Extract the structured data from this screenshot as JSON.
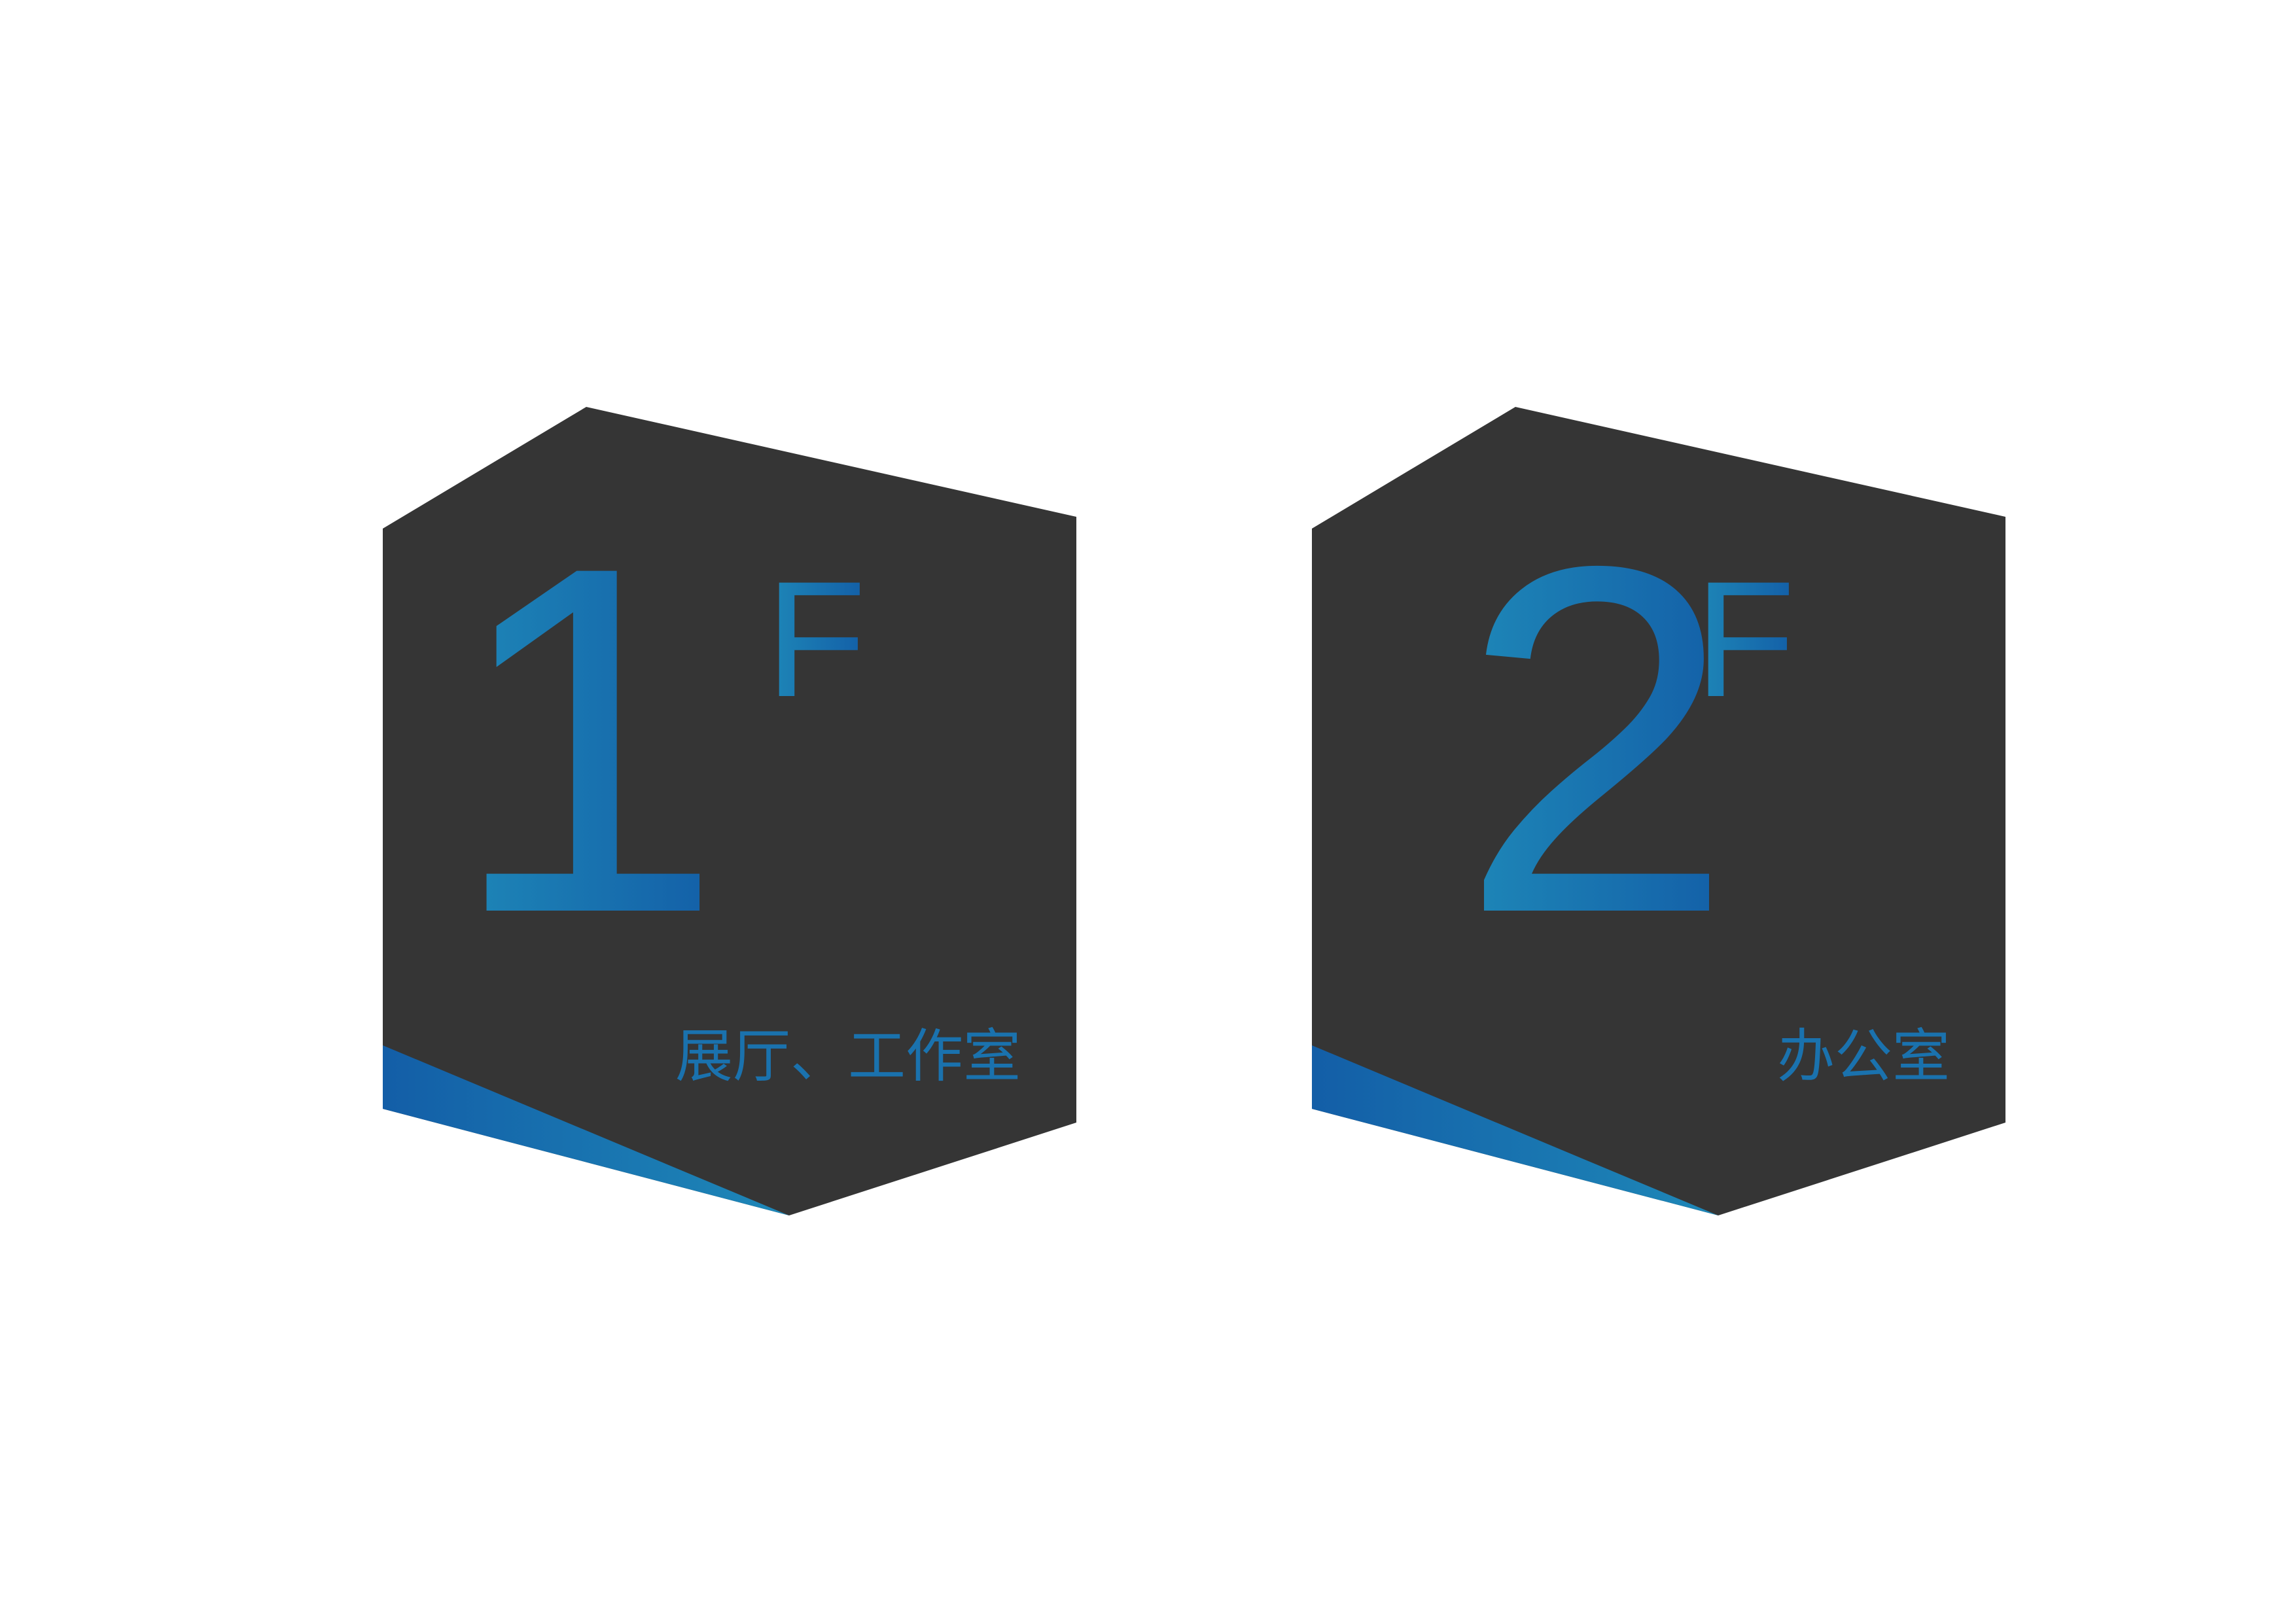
{
  "colors": {
    "plate": "#353535",
    "accent_light": "#1e88b8",
    "accent_dark": "#135ea7",
    "background": "#ffffff"
  },
  "signs": [
    {
      "number": "1",
      "unit": "F",
      "label": "展厅、工作室"
    },
    {
      "number": "2",
      "unit": "F",
      "label": "办公室"
    }
  ]
}
